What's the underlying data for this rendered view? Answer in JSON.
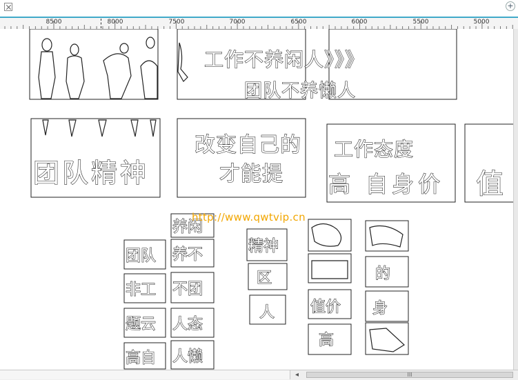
{
  "ruler": {
    "labels": [
      "8500",
      "8000",
      "7500",
      "7000",
      "6500",
      "6000",
      "5500",
      "5000"
    ]
  },
  "panels": {
    "slogan_lazy_line1": "工作不养闲人》》》",
    "slogan_lazy_line2": "团队不养懒人",
    "slogan_team_spirit": "团队精神",
    "slogan_change_line1": "改变自己的",
    "slogan_change_line2": "才能提",
    "slogan_attitude_line1": "工作态度",
    "slogan_attitude_line2": "高 自身价",
    "slogan_value": "值"
  },
  "letter_tiles": {
    "col1": [
      "团队",
      "非工",
      "题云",
      "高自"
    ],
    "col2": [
      "养闲",
      "养不",
      "不团",
      "人态",
      "人懒"
    ],
    "col3": [
      "精神",
      "区",
      "人"
    ],
    "col4": [
      "值价",
      "高"
    ],
    "col5": [
      "的",
      "身"
    ]
  },
  "watermark": "http://www.qwtvip.cn",
  "statusbar": {
    "thumb_grip": "III"
  }
}
